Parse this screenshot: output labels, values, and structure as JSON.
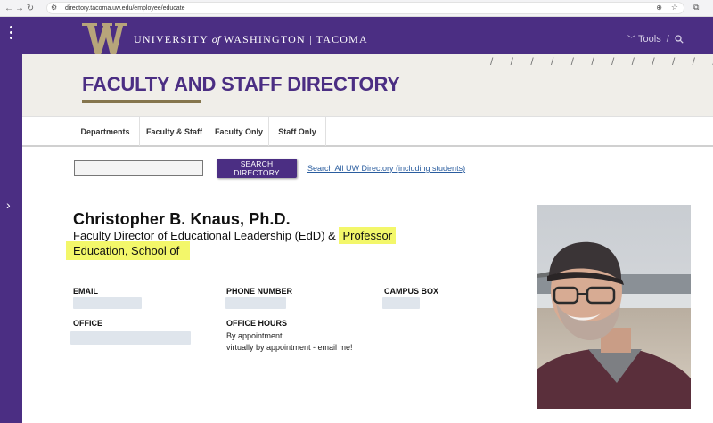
{
  "browser": {
    "url": "directory.tacoma.uw.edu/employee/educate",
    "back_icon": "arrow-left-icon",
    "forward_icon": "arrow-right-icon",
    "reload_icon": "reload-icon"
  },
  "header": {
    "wordmark_prefix": "UNIVERSITY",
    "wordmark_of": "of",
    "wordmark_suffix": "WASHINGTON | TACOMA",
    "tools_label": "Tools",
    "brand_color": "#4b2e83",
    "gold_color": "#85754d"
  },
  "banner": {
    "title": "FACULTY AND STAFF DIRECTORY",
    "slashes": "/ / / / / / / / / / / /"
  },
  "tabs": [
    {
      "label": "Departments"
    },
    {
      "label": "Faculty & Staff"
    },
    {
      "label": "Faculty Only"
    },
    {
      "label": "Staff Only"
    }
  ],
  "search": {
    "input_value": "",
    "button_label": "SEARCH DIRECTORY",
    "all_link": "Search All UW Directory (including students)"
  },
  "profile": {
    "name": "Christopher B. Knaus, Ph.D.",
    "title_prefix": "Faculty Director of Educational Leadership (EdD) &",
    "title_highlight": "Professor",
    "department": "Education, School of",
    "fields": {
      "email_label": "EMAIL",
      "phone_label": "PHONE NUMBER",
      "campus_box_label": "CAMPUS BOX",
      "office_label": "OFFICE",
      "office_hours_label": "OFFICE HOURS",
      "office_hours_line1": "By appointment",
      "office_hours_line2": "virtually by appointment - email me!"
    }
  }
}
